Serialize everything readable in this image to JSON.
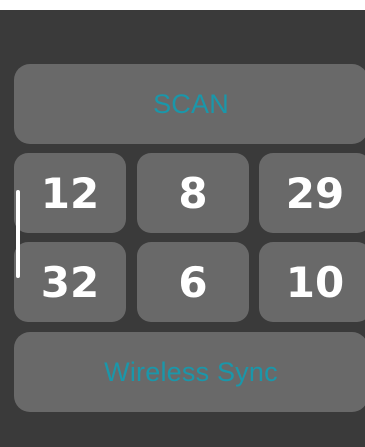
{
  "buttons": {
    "scan_label": "SCAN",
    "wireless_sync_label": "Wireless Sync"
  },
  "values": {
    "row1": [
      "12",
      "8",
      "29"
    ],
    "row2": [
      "32",
      "6",
      "10"
    ]
  },
  "colors": {
    "background": "#3a3a3a",
    "button": "#696969",
    "accent_text": "#1a97aa",
    "value_text": "#ffffff"
  }
}
